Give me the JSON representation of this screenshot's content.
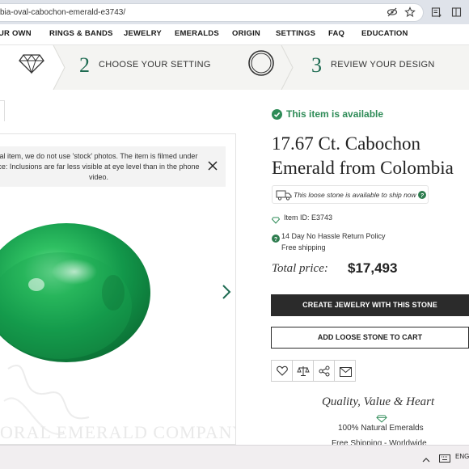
{
  "browser": {
    "url": "bia-oval-cabochon-emerald-e3743/",
    "icons": [
      "eye-off-icon",
      "star-icon",
      "reader-icon",
      "bookmark-icon"
    ]
  },
  "nav": {
    "items": [
      "UR OWN",
      "RINGS & BANDS",
      "JEWELRY",
      "EMERALDS",
      "ORIGIN",
      "SETTINGS",
      "FAQ",
      "EDUCATION"
    ]
  },
  "steps": {
    "step2_number": "2",
    "step2_label": "CHOOSE YOUR SETTING",
    "step3_number": "3",
    "step3_label": "REVIEW YOUR DESIGN"
  },
  "viewer": {
    "notice": "al item, we do not use 'stock' photos. The item is filmed under ce: Inclusions are far less visible at eye level than in the phone video.",
    "notice_line1": "al item, we do not use 'stock' photos. The item is filmed under",
    "notice_line2": "ce: Inclusions are far less visible at eye level than in the phone",
    "notice_line3": "video.",
    "watermark": "ORAL EMERALD COMPANY"
  },
  "product": {
    "availability": "This item is available",
    "title_line1": "17.67 Ct. Cabochon",
    "title_line2": "Emerald from Colombia",
    "ship_note": "This loose stone is available to ship now",
    "item_id": "Item ID: E3743",
    "return_policy": "14 Day No Hassle Return Policy",
    "shipping": "Free shipping",
    "total_label": "Total price:",
    "price": "$17,493",
    "primary_button": "CREATE JEWELRY WITH THIS STONE",
    "secondary_button": "ADD LOOSE STONE TO CART",
    "tagline": "Quality, Value & Heart",
    "feature1": "100% Natural Emeralds",
    "feature2": "Free Shipping - Worldwide"
  },
  "taskbar": {
    "lang": "ENG"
  },
  "colors": {
    "accent_green": "#1e6b52",
    "available_green": "#2e8b57",
    "button_dark": "#2b2b2b",
    "emerald": "#1faa4e"
  }
}
